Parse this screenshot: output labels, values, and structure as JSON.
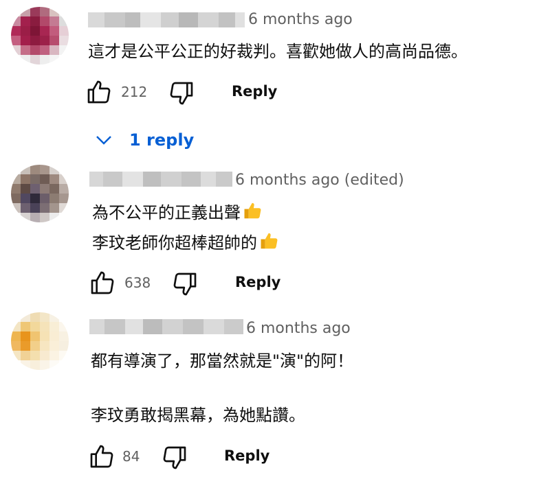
{
  "comments": [
    {
      "meta": "6 months ago",
      "lines": [
        "這才是公平公正的好裁判。喜歡她做人的高尚品德。"
      ],
      "likes": "212",
      "reply_label": "Reply",
      "replies_toggle": "1 reply",
      "icons": {
        "like": "thumb-up-icon",
        "dislike": "thumb-down-icon",
        "chevron": "chevron-down-icon"
      }
    },
    {
      "meta": "6 months ago (edited)",
      "lines": [
        "為不公平的正義出聲",
        "李玟老師你超棒超帥的"
      ],
      "likes": "638",
      "reply_label": "Reply",
      "icons": {
        "like": "thumb-up-icon",
        "dislike": "thumb-down-icon",
        "emoji": "thumbs-up-emoji"
      }
    },
    {
      "meta": "6 months ago",
      "lines": [
        "都有導演了，那當然就是\"演\"的阿！",
        "李玟勇敢揭黑幕，為她點讚。"
      ],
      "likes": "84",
      "reply_label": "Reply",
      "icons": {
        "like": "thumb-up-icon",
        "dislike": "thumb-down-icon"
      }
    }
  ],
  "colors": {
    "link_blue": "#065fd4",
    "meta_gray": "#606060",
    "text": "#0f0f0f"
  }
}
